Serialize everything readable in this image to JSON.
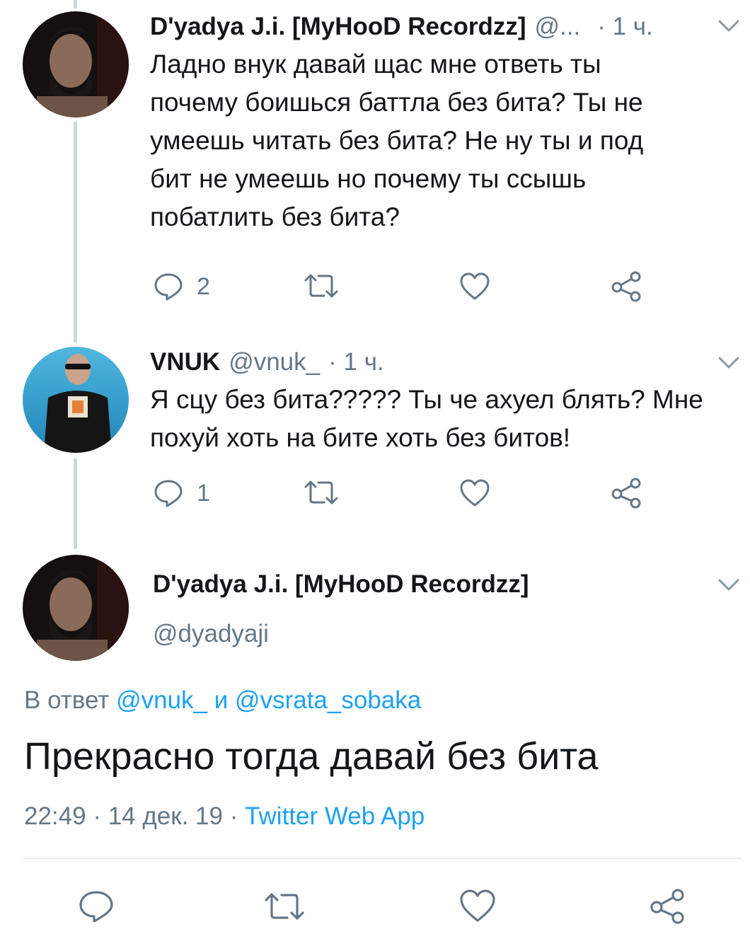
{
  "tweet1": {
    "author_name": "D'yadya J.i. [MyHooD Recordzz]",
    "handle": "@...",
    "time": "· 1 ч.",
    "lines": [
      "Ладно внук давай щас мне ответь ты",
      "почему боишься баттла без бита? Ты не",
      "умеешь читать без бита? Не ну ты и под",
      "бит не умеешь но почему ты ссышь",
      "побатлить без бита?"
    ],
    "reply_count": "2"
  },
  "tweet2": {
    "author_name": "VNUK",
    "handle": "@vnuk_",
    "time": "· 1 ч.",
    "lines": [
      "Я сцу без бита????? Ты че ахуел блять? Мне",
      "похуй хоть на бите хоть без битов!"
    ],
    "reply_count": "1"
  },
  "main_tweet": {
    "author_name": "D'yadya J.i. [MyHooD Recordzz]",
    "handle": "@dyadyaji",
    "reply_prefix": "В ответ",
    "reply_to_1": "@vnuk_",
    "reply_and": "и",
    "reply_to_2": "@vsrata_sobaka",
    "text": "Прекрасно тогда давай без бита",
    "time": "22:49",
    "sep1": "·",
    "date": "14 дек. 19",
    "sep2": "·",
    "source": "Twitter Web App"
  },
  "colors": {
    "link": "#1da1f2",
    "secondary_text": "#657786",
    "primary_text": "#14171a",
    "thread_line": "#ccd6dd"
  },
  "icons": [
    "reply-icon",
    "retweet-icon",
    "like-icon",
    "share-icon",
    "chevron-down-icon"
  ]
}
